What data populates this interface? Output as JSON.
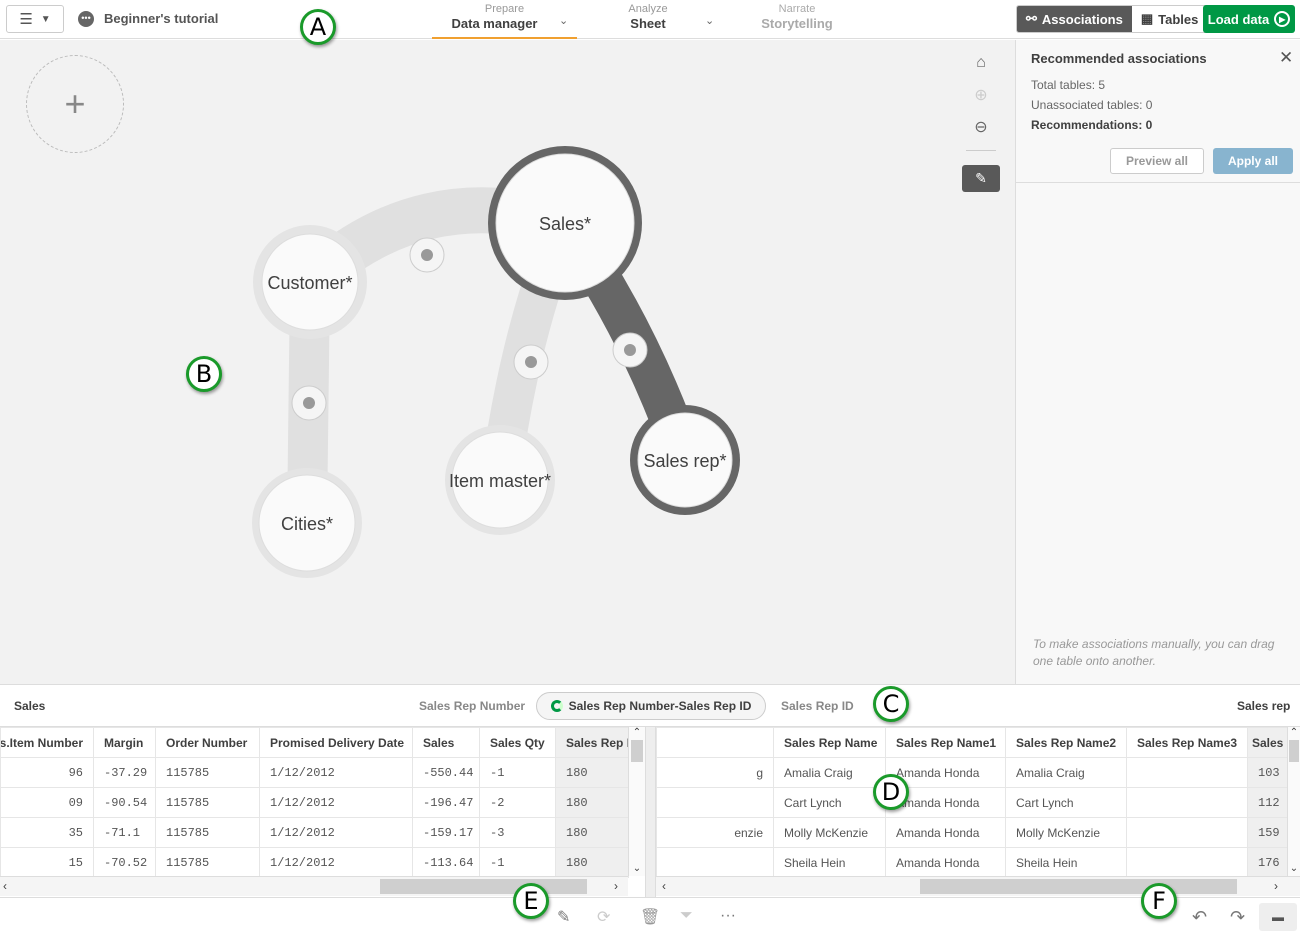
{
  "topbar": {
    "app_title": "Beginner's tutorial",
    "nav": [
      {
        "sub": "Prepare",
        "main": "Data manager"
      },
      {
        "sub": "Analyze",
        "main": "Sheet"
      },
      {
        "sub": "Narrate",
        "main": "Storytelling"
      }
    ],
    "associations_label": "Associations",
    "tables_label": "Tables",
    "load_label": "Load data"
  },
  "diagram": {
    "nodes": [
      "Sales*",
      "Customer*",
      "Cities*",
      "Item master*",
      "Sales rep*"
    ]
  },
  "panel": {
    "title": "Recommended associations",
    "total": "Total tables: 5",
    "unassociated": "Unassociated tables: 0",
    "recommendations": "Recommendations: 0",
    "preview": "Preview all",
    "apply": "Apply all",
    "note": "To make associations manually, you can drag one table onto another."
  },
  "assoc": {
    "left_table": "Sales",
    "left_field": "Sales Rep Number",
    "pill": "Sales Rep Number-Sales Rep ID",
    "right_field": "Sales Rep ID",
    "right_table": "Sales rep"
  },
  "left_table": {
    "headers": [
      "s.Item Number",
      "Margin",
      "Order Number",
      "Promised Delivery Date",
      "Sales",
      "Sales Qty",
      "Sales Rep N"
    ],
    "rows": [
      [
        "96",
        "-37.29",
        "115785",
        "1/12/2012",
        "-550.44",
        "-1",
        "180"
      ],
      [
        "09",
        "-90.54",
        "115785",
        "1/12/2012",
        "-196.47",
        "-2",
        "180"
      ],
      [
        "35",
        "-71.1",
        "115785",
        "1/12/2012",
        "-159.17",
        "-3",
        "180"
      ],
      [
        "15",
        "-70.52",
        "115785",
        "1/12/2012",
        "-113.64",
        "-1",
        "180"
      ]
    ]
  },
  "right_table": {
    "headers": [
      "",
      "Sales Rep Name",
      "Sales Rep Name1",
      "Sales Rep Name2",
      "Sales Rep Name3",
      "Sales"
    ],
    "rows": [
      [
        "g",
        "Amalia Craig",
        "Amanda Honda",
        "Amalia Craig",
        "",
        "103"
      ],
      [
        "",
        "Cart Lynch",
        "Amanda Honda",
        "Cart Lynch",
        "",
        "112"
      ],
      [
        "enzie",
        "Molly McKenzie",
        "Amanda Honda",
        "Molly McKenzie",
        "",
        "159"
      ],
      [
        "",
        "Sheila Hein",
        "Amanda Honda",
        "Sheila Hein",
        "",
        "176"
      ]
    ]
  },
  "callouts": [
    "A",
    "B",
    "C",
    "D",
    "E",
    "F"
  ]
}
